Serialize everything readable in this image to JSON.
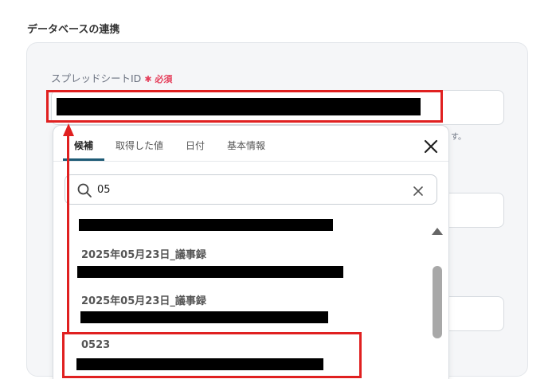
{
  "section": {
    "title": "データベースの連携"
  },
  "field": {
    "label": "スプレッドシートID",
    "required": "✱ 必須"
  },
  "hint": {
    "text": "す。"
  },
  "dropdown": {
    "tabs": [
      {
        "label": "候補"
      },
      {
        "label": "取得した値"
      },
      {
        "label": "日付"
      },
      {
        "label": "基本情報"
      }
    ],
    "search": {
      "value": "05"
    },
    "items": [
      {
        "title": ""
      },
      {
        "title": "2025年05月23日_議事録"
      },
      {
        "title": "2025年05月23日_議事録"
      },
      {
        "title": "0523"
      }
    ]
  },
  "icons": {
    "close": "close-icon",
    "search": "search-icon",
    "clear": "clear-icon",
    "scroll_up": "chevron-up-icon"
  },
  "colors": {
    "accent_tab": "#1e5b76",
    "required": "#e53e5a",
    "annotation": "#e02020",
    "scrollbar": "#a8a8a8"
  }
}
